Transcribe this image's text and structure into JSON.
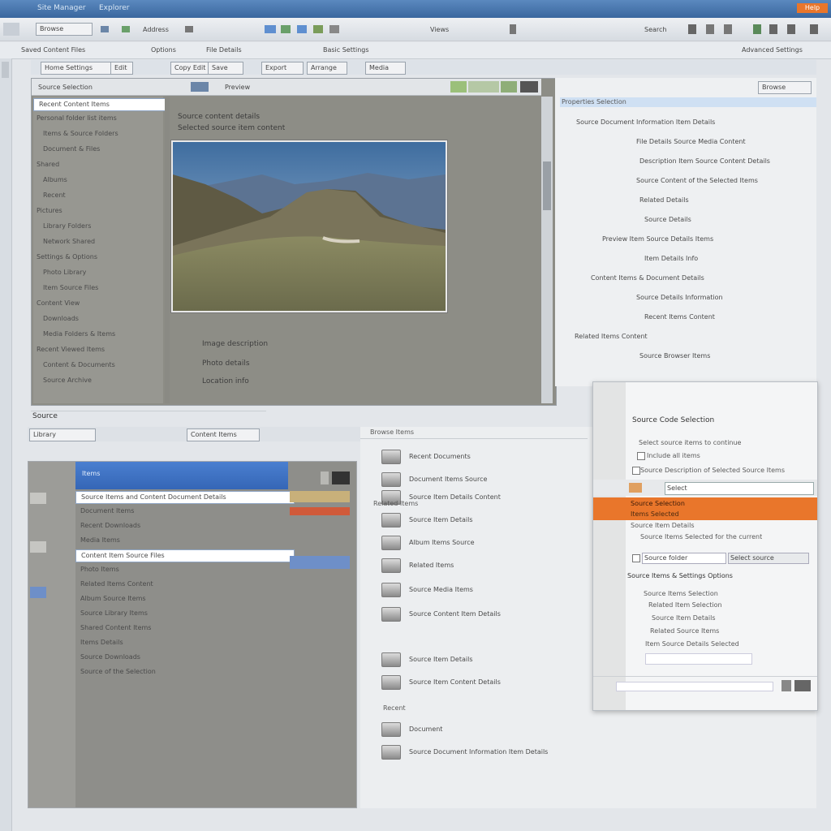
{
  "titlebar": {
    "title": "Site Manager",
    "app": "Explorer",
    "right_badge": "Help"
  },
  "toolbar": {
    "button_1": "Browse",
    "address": "Address",
    "view_label": "Views",
    "search": "Search"
  },
  "menubar": {
    "left": "Saved Content Files",
    "center_1": "Options",
    "center_2": "File Details",
    "center_3": "Basic Settings",
    "right": "Advanced Settings"
  },
  "tabs": [
    "Home Settings",
    "Edit",
    "Copy Edit",
    "Save",
    "Export",
    "Arrange",
    "Media"
  ],
  "viewer": {
    "header_title": "Source Selection",
    "header_sub": "Preview",
    "tree_header": "Recent Content Items",
    "tree_items": [
      "Personal folder list items",
      "Items & Source Folders",
      "Document & Files",
      "Shared",
      "Albums",
      "Recent",
      "Pictures",
      "Library Folders",
      "Network Shared",
      "Settings & Options",
      "Photo Library",
      "Item Source Files",
      "Content View",
      "Downloads",
      "Media Folders & Items",
      "Recent Viewed Items",
      "Content & Documents",
      "Source Archive"
    ],
    "content_lines": [
      "Source content details",
      "Selected source item content"
    ],
    "caption_lines": [
      "Image description",
      "Photo details",
      "Location info"
    ]
  },
  "properties": {
    "header": "Properties Selection",
    "lines": [
      "Source Document Information Item Details",
      "File Details Source Media Content",
      "Description Item Source Content Details",
      "Source Content of the Selected Items",
      "Related Details",
      "Source Details",
      "Preview Item Source Details Items",
      "Item Details Info",
      "Content Items & Document Details",
      "Source Details Information",
      "Recent Items Content",
      "Related Items Content",
      "Source Browser Items"
    ],
    "button": "Browse"
  },
  "bottom_left": {
    "title": "Source",
    "tab_1": "Library",
    "tab_2": "Content Items",
    "list_header": "Items",
    "rows": [
      "Source Items and Content Document Details",
      "Document Items",
      "Recent Downloads",
      "Media Items",
      "Content Item Source Files",
      "Photo Items",
      "Related Items Content",
      "Album Source Items",
      "Source Library Items",
      "Shared Content Items",
      "Items Details",
      "Source Downloads",
      "Source of the Selection"
    ]
  },
  "bottom_mid": {
    "header": "Browse Items",
    "items": [
      "Recent Documents",
      "Document Items Source",
      "Source Item Details Content",
      "Source Item Details",
      "Album Items Source",
      "Related Items",
      "Source Media Items",
      "Source Content Item Details",
      "Source Item Details",
      "Source Item Content Details",
      "Document",
      "Source Document Information Item Details"
    ],
    "section_1": "Related Items",
    "section_2": "Recent"
  },
  "dialog": {
    "title": "Source Code Selection",
    "subtitle": "Select source items to continue",
    "check_1": "Include all items",
    "desc": "Source Description of Selected Source Items",
    "field_label": "Select",
    "highlight": "Source Selection",
    "highlight_sub": "Items Selected",
    "line_a": "Source Item Details",
    "line_b": "Source Items Selected for the current",
    "field_2": "Source folder",
    "field_2b": "Select source",
    "group": "Source Items & Settings Options",
    "sub_1": "Source Items Selection",
    "sub_2": "Related Item Selection",
    "sub_3": "Source Item Details",
    "sub_4": "Related Source Items",
    "sub_5": "Item Source Details Selected"
  },
  "colors": {
    "titlebar": "#3f6fa8",
    "accent_orange": "#e9762b",
    "selection_blue": "#3a6fc4"
  }
}
